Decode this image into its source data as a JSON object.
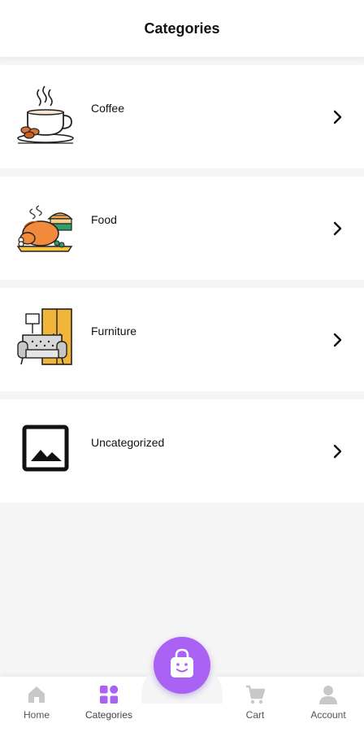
{
  "header": {
    "title": "Categories"
  },
  "categories": [
    {
      "label": "Coffee",
      "icon": "coffee-cup-icon"
    },
    {
      "label": "Food",
      "icon": "roast-chicken-food-icon"
    },
    {
      "label": "Furniture",
      "icon": "sofa-furniture-icon"
    },
    {
      "label": "Uncategorized",
      "icon": "image-placeholder-icon"
    }
  ],
  "bottom_nav": {
    "items": [
      {
        "label": "Home",
        "icon": "home-icon",
        "active": false
      },
      {
        "label": "Categories",
        "icon": "categories-grid-icon",
        "active": true
      },
      {
        "label": "Cart",
        "icon": "cart-icon",
        "active": false
      },
      {
        "label": "Account",
        "icon": "account-icon",
        "active": false
      }
    ],
    "center_button": {
      "icon": "shopping-bag-smile-icon"
    }
  },
  "colors": {
    "accent": "#a962f4",
    "inactive_icon": "#c8c8c8",
    "background": "#f5f5f5"
  }
}
